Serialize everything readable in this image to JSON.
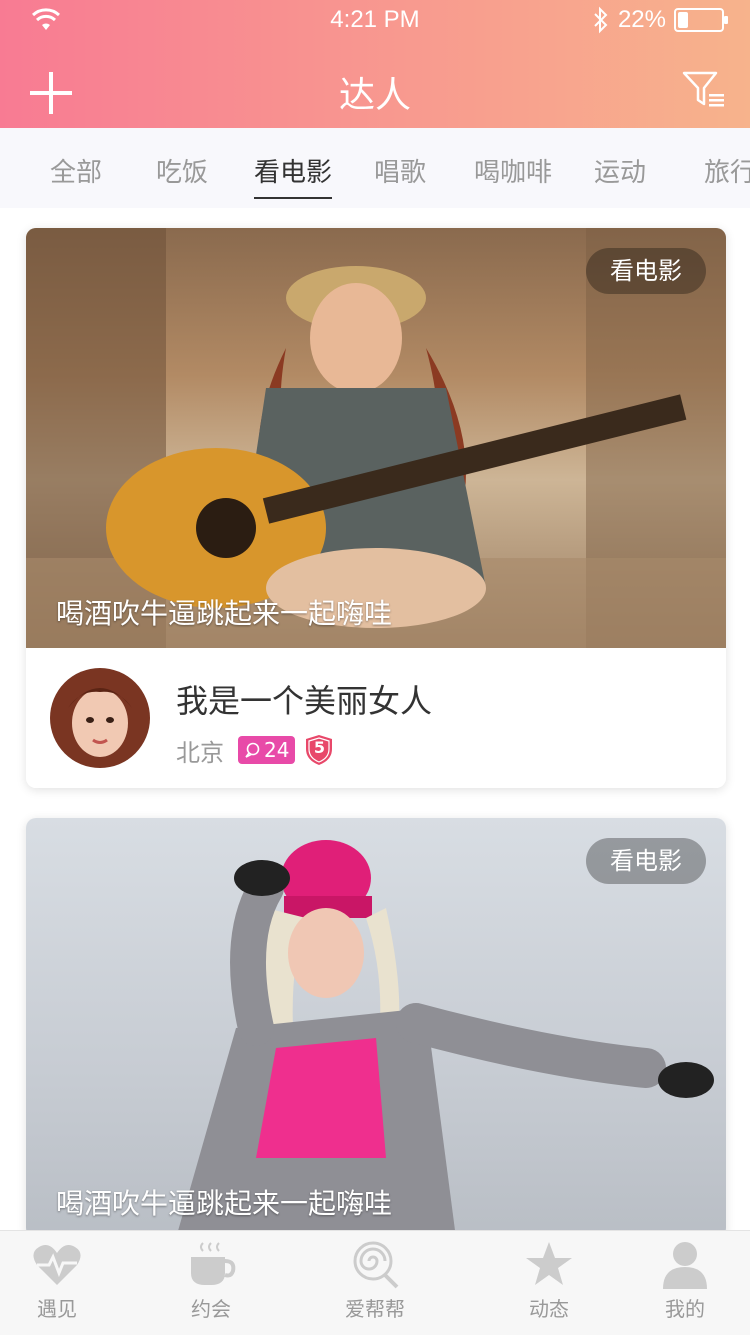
{
  "status_bar": {
    "time": "4:21 PM",
    "battery": "22%"
  },
  "header": {
    "title": "达人",
    "add_icon": "plus-icon",
    "filter_icon": "filter-icon"
  },
  "tabs": [
    {
      "label": "全部",
      "active": false
    },
    {
      "label": "吃饭",
      "active": false
    },
    {
      "label": "看电影",
      "active": true
    },
    {
      "label": "唱歌",
      "active": false
    },
    {
      "label": "喝咖啡",
      "active": false
    },
    {
      "label": "运动",
      "active": false
    },
    {
      "label": "旅行",
      "active": false
    }
  ],
  "cards": [
    {
      "category": "看电影",
      "caption": "喝酒吹牛逼跳起来一起嗨哇",
      "name": "我是一个美丽女人",
      "city": "北京",
      "message_count": "24",
      "level": "5"
    },
    {
      "category": "看电影",
      "caption": "喝酒吹牛逼跳起来一起嗨哇"
    }
  ],
  "tabbar": [
    {
      "label": "遇见",
      "icon": "heart-pulse-icon"
    },
    {
      "label": "约会",
      "icon": "coffee-cup-icon"
    },
    {
      "label": "爱帮帮",
      "icon": "lollipop-icon"
    },
    {
      "label": "动态",
      "icon": "star-icon"
    },
    {
      "label": "我的",
      "icon": "person-icon"
    }
  ],
  "colors": {
    "header_gradient_start": "#f87b93",
    "header_gradient_end": "#f7b38c",
    "tab_bg": "#f8f8fc",
    "text_primary": "#333333",
    "text_secondary": "#999999",
    "badge_pink": "#e84aa8",
    "tabbar_icon": "#cccccc"
  }
}
